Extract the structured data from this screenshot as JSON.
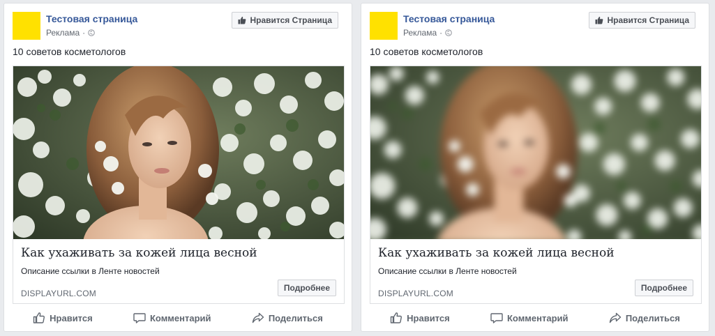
{
  "ads": [
    {
      "page_name": "Тестовая страница",
      "sponsored": "Реклама",
      "sponsored_separator": "·",
      "like_page_label": "Нравится Страница",
      "post_text": "10 советов косметологов",
      "link": {
        "title": "Как ухаживать за кожей лица весной",
        "description": "Описание ссылки в Ленте новостей",
        "display_url": "DISPLAYURL.COM",
        "cta_label": "Подробнее",
        "image_icon": "photo-woman-in-blossoms",
        "image_blurred": false
      },
      "actions": {
        "like": "Нравится",
        "comment": "Комментарий",
        "share": "Поделиться"
      }
    },
    {
      "page_name": "Тестовая страница",
      "sponsored": "Реклама",
      "sponsored_separator": "·",
      "like_page_label": "Нравится Страница",
      "post_text": "10 советов косметологов",
      "link": {
        "title": "Как ухаживать за кожей лица весной",
        "description": "Описание ссылки в Ленте новостей",
        "display_url": "DISPLAYURL.COM",
        "cta_label": "Подробнее",
        "image_icon": "photo-woman-in-blossoms-pixelated",
        "image_blurred": true
      },
      "actions": {
        "like": "Нравится",
        "comment": "Комментарий",
        "share": "Поделиться"
      }
    }
  ],
  "colors": {
    "avatar": "#ffe100",
    "page_name": "#365899",
    "meta_text": "#616770",
    "button_bg": "#f6f7f9"
  }
}
